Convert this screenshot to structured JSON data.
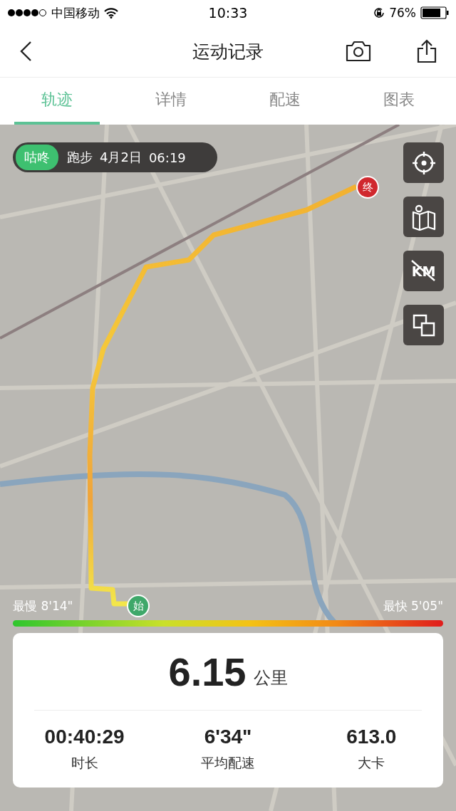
{
  "status_bar": {
    "carrier": "中国移动",
    "time": "10:33",
    "battery": "76%"
  },
  "nav": {
    "title": "运动记录"
  },
  "tabs": [
    {
      "label": "轨迹",
      "selected": true
    },
    {
      "label": "详情",
      "selected": false
    },
    {
      "label": "配速",
      "selected": false
    },
    {
      "label": "图表",
      "selected": false
    }
  ],
  "map": {
    "badge": {
      "tag": "咕咚",
      "activity": "跑步",
      "date": "4月2日",
      "time": "06:19"
    },
    "start_marker": "始",
    "end_marker": "终",
    "units_toggle": "KM",
    "pace_legend": {
      "slowest": "最慢 8'14\"",
      "fastest": "最快 5'05\""
    }
  },
  "summary": {
    "distance": "6.15",
    "unit": "公里",
    "stats": [
      {
        "value": "00:40:29",
        "label": "时长"
      },
      {
        "value": "6'34\"",
        "label": "平均配速"
      },
      {
        "value": "613.0",
        "label": "大卡"
      }
    ]
  }
}
